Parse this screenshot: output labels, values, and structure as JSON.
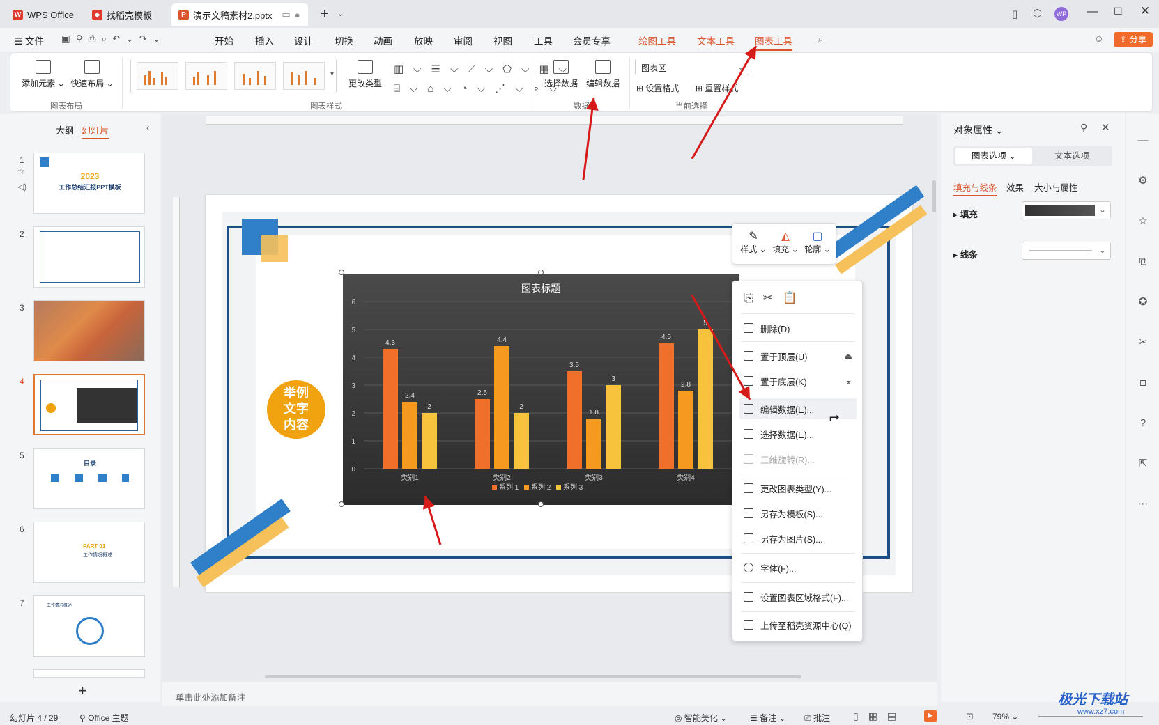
{
  "tabs": [
    {
      "label": "WPS Office"
    },
    {
      "label": "找稻壳模板"
    },
    {
      "label": "演示文稿素材2.pptx"
    }
  ],
  "window_controls": {
    "user_badge": "WP"
  },
  "menubar": {
    "file": "文件",
    "items": [
      "开始",
      "插入",
      "设计",
      "切换",
      "动画",
      "放映",
      "审阅",
      "视图",
      "工具",
      "会员专享"
    ],
    "tool_tabs": [
      "绘图工具",
      "文本工具",
      "图表工具"
    ],
    "share": "分享"
  },
  "ribbon": {
    "add_element": "添加元素",
    "quick_layout": "快速布局",
    "group_layout": "图表布局",
    "change_type": "更改类型",
    "group_style": "图表样式",
    "select_data": "选择数据",
    "edit_data": "编辑数据",
    "group_data": "数据",
    "selection_value": "图表区",
    "set_format": "设置格式",
    "reset_style": "重置样式",
    "group_selection": "当前选择"
  },
  "leftpanel": {
    "outline_tab": "大纲",
    "slides_tab": "幻灯片",
    "slides": [
      {
        "num": "1",
        "title": "2023",
        "subtitle": "工作总结汇报PPT模板"
      },
      {
        "num": "2"
      },
      {
        "num": "3"
      },
      {
        "num": "4"
      },
      {
        "num": "5",
        "title": "目录"
      },
      {
        "num": "6",
        "title": "PART 01",
        "subtitle": "工作情况概述"
      },
      {
        "num": "7",
        "title": "工作情况概述"
      }
    ]
  },
  "slide": {
    "badge_text_1": "举例",
    "badge_text_2": "文字",
    "badge_text_3": "内容"
  },
  "chart_data": {
    "type": "bar",
    "title": "图表标题",
    "categories": [
      "类别1",
      "类别2",
      "类别3",
      "类别4"
    ],
    "series": [
      {
        "name": "系列 1",
        "values": [
          4.3,
          2.5,
          3.5,
          4.5
        ],
        "color": "#f06f2a"
      },
      {
        "name": "系列 2",
        "values": [
          2.4,
          4.4,
          1.8,
          2.8
        ],
        "color": "#f59a1e"
      },
      {
        "name": "系列 3",
        "values": [
          2,
          2,
          3,
          5
        ],
        "color": "#f8c33c"
      }
    ],
    "ylim": [
      0,
      6
    ],
    "yticks": [
      "0",
      "1",
      "2",
      "3",
      "4",
      "5",
      "6"
    ],
    "grid": true,
    "legend": "bottom"
  },
  "floatbar": {
    "style": "样式",
    "fill": "填充",
    "outline": "轮廓"
  },
  "context_menu": {
    "delete": "删除(D)",
    "bring_front": "置于顶层(U)",
    "send_back": "置于底层(K)",
    "edit_data": "编辑数据(E)...",
    "select_data": "选择数据(E)...",
    "rotate_3d": "三维旋转(R)...",
    "change_type": "更改图表类型(Y)...",
    "save_template": "另存为模板(S)...",
    "save_image": "另存为图片(S)...",
    "font": "字体(F)...",
    "format_area": "设置图表区域格式(F)...",
    "upload": "上传至稻壳资源中心(Q)"
  },
  "rpanel": {
    "title": "对象属性",
    "tab_chart": "图表选项",
    "tab_text": "文本选项",
    "sub_fill_line": "填充与线条",
    "sub_effect": "效果",
    "sub_size": "大小与属性",
    "fill_label": "填充",
    "line_label": "线条"
  },
  "notes_placeholder": "单击此处添加备注",
  "status": {
    "slide_count": "幻灯片 4 / 29",
    "theme": "Office 主题",
    "smart": "智能美化",
    "notes": "备注",
    "comments": "批注",
    "zoom": "79%"
  },
  "watermark": {
    "site": "极光下载站",
    "url": "www.xz7.com"
  }
}
